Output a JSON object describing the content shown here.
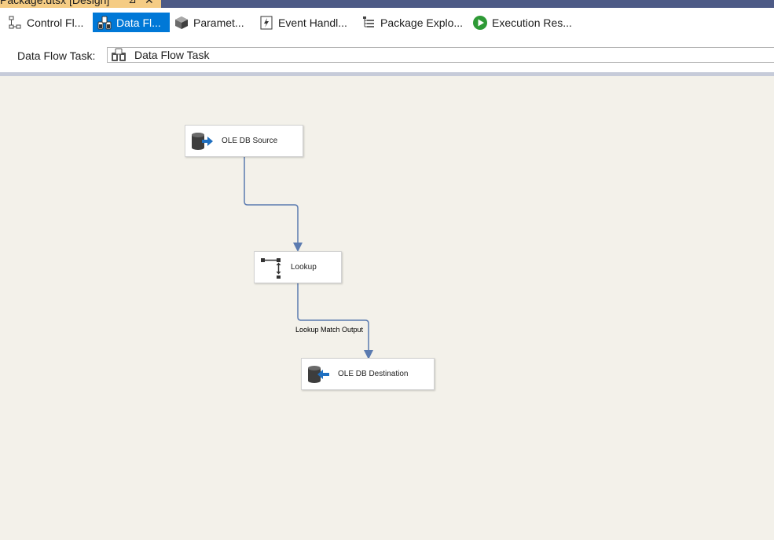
{
  "document_tab": {
    "title": "Package.dtsx [Design]",
    "pin": "⊿",
    "close": "✕"
  },
  "designer_tabs": [
    {
      "label": "Control Fl...",
      "icon": "control-flow-icon",
      "active": false
    },
    {
      "label": "Data Fl...",
      "icon": "data-flow-icon",
      "active": true
    },
    {
      "label": "Paramet...",
      "icon": "parameters-icon",
      "active": false
    },
    {
      "label": "Event Handl...",
      "icon": "event-handlers-icon",
      "active": false
    },
    {
      "label": "Package Explo...",
      "icon": "package-explorer-icon",
      "active": false
    },
    {
      "label": "Execution Res...",
      "icon": "execution-results-icon",
      "active": false
    }
  ],
  "task_selector": {
    "label": "Data Flow Task:",
    "value": "Data Flow Task",
    "icon": "data-flow-task-icon"
  },
  "components": {
    "source": {
      "label": "OLE DB Source",
      "icon": "ole-db-source-icon"
    },
    "lookup": {
      "label": "Lookup",
      "icon": "lookup-icon"
    },
    "destination": {
      "label": "OLE DB Destination",
      "icon": "ole-db-destination-icon"
    }
  },
  "paths": {
    "lookup_to_destination_label": "Lookup Match Output"
  },
  "colors": {
    "active_tab": "#0078d7",
    "canvas": "#f3f1ea",
    "path": "#5b7bb0",
    "doc_tab": "#f5cc84"
  }
}
